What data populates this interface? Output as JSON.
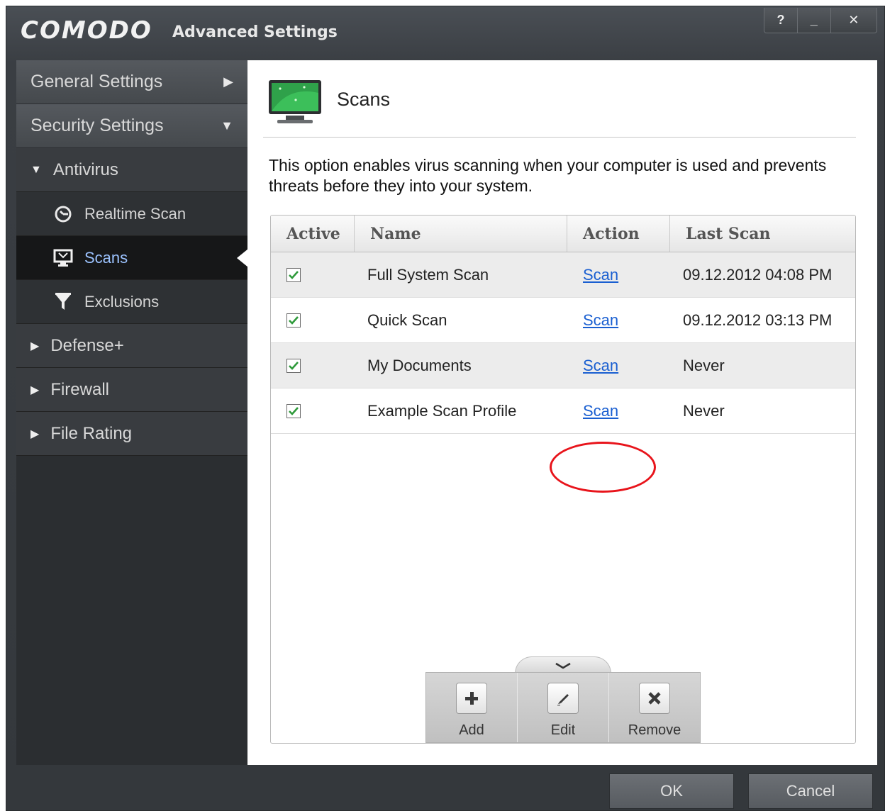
{
  "window": {
    "brand": "COMODO",
    "title": "Advanced Settings",
    "controls": {
      "help": "?",
      "minimize": "_",
      "close": "✕"
    }
  },
  "sidebar": {
    "general": {
      "label": "General Settings",
      "arrow": "▶"
    },
    "security": {
      "label": "Security Settings",
      "arrow": "▼"
    },
    "antivirus": {
      "label": "Antivirus",
      "tri": "▼"
    },
    "realtime": {
      "label": "Realtime Scan"
    },
    "scans": {
      "label": "Scans"
    },
    "exclusions": {
      "label": "Exclusions"
    },
    "defense": {
      "label": "Defense+",
      "tri": "▶"
    },
    "firewall": {
      "label": "Firewall",
      "tri": "▶"
    },
    "filerating": {
      "label": "File Rating",
      "tri": "▶"
    }
  },
  "main": {
    "title": "Scans",
    "description": "This option enables virus scanning when your computer is used and prevents threats before they into your system."
  },
  "table": {
    "headers": {
      "active": "Active",
      "name": "Name",
      "action": "Action",
      "last_scan": "Last Scan"
    },
    "rows": [
      {
        "name": "Full System Scan",
        "action": "Scan",
        "last_scan": "09.12.2012 04:08 PM"
      },
      {
        "name": "Quick Scan",
        "action": "Scan",
        "last_scan": "09.12.2012 03:13 PM"
      },
      {
        "name": "My Documents",
        "action": "Scan",
        "last_scan": "Never"
      },
      {
        "name": "Example Scan Profile",
        "action": "Scan",
        "last_scan": "Never"
      }
    ]
  },
  "toolbar": {
    "add": "Add",
    "edit": "Edit",
    "remove": "Remove"
  },
  "footer": {
    "ok": "OK",
    "cancel": "Cancel"
  },
  "colors": {
    "link": "#1a5fd1",
    "highlight": "#e8141b",
    "check": "#2e9a3a"
  }
}
